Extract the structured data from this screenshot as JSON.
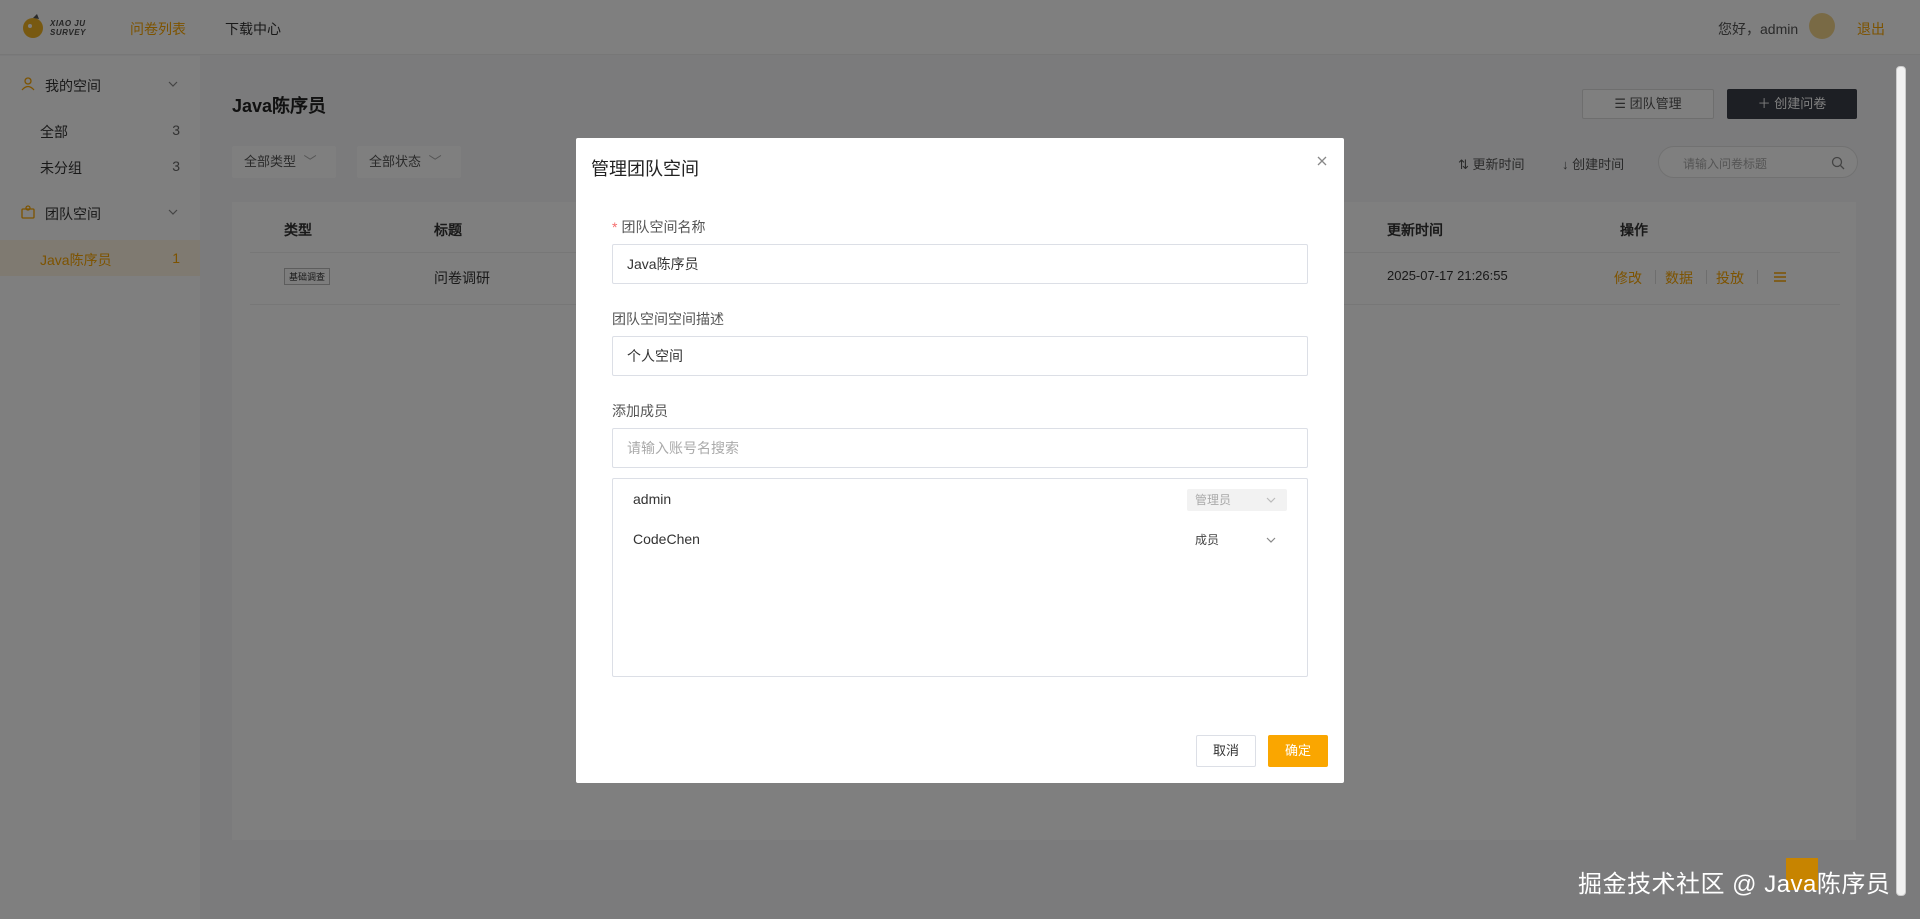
{
  "header": {
    "logo_text_line1": "XIAO JU",
    "logo_text_line2": "SURVEY",
    "nav": [
      {
        "label": "问卷列表",
        "active": true
      },
      {
        "label": "下载中心",
        "active": false
      }
    ],
    "greeting": "您好，admin",
    "logout_label": "退出",
    "accent_color": "#faa600"
  },
  "sidebar": {
    "groups": [
      {
        "label": "我的空间",
        "icon": "user-icon",
        "items": [
          {
            "label": "全部",
            "count": "3"
          },
          {
            "label": "未分组",
            "count": "3"
          }
        ]
      },
      {
        "label": "团队空间",
        "icon": "team-icon",
        "items": [
          {
            "label": "Java陈序员",
            "count": "1",
            "active": true
          }
        ]
      }
    ]
  },
  "main": {
    "title": "Java陈序员",
    "team_manage_label": "团队管理",
    "create_label": "创建问卷",
    "filters": [
      "全部类型",
      "全部状态"
    ],
    "sorts": [
      "更新时间",
      "创建时间"
    ],
    "search_placeholder": "请输入问卷标题",
    "table": {
      "headers": [
        "类型",
        "标题",
        "更新时间",
        "操作"
      ],
      "rows": [
        {
          "type_tag": "基础调查",
          "title": "问卷调研",
          "updated": "2025-07-17 21:26:55",
          "actions": [
            "修改",
            "数据",
            "投放"
          ]
        }
      ]
    }
  },
  "modal": {
    "title": "管理团队空间",
    "name_label": "团队空间名称",
    "name_value": "Java陈序员",
    "desc_label": "团队空间空间描述",
    "desc_value": "个人空间",
    "member_label": "添加成员",
    "member_placeholder": "请输入账号名搜索",
    "members": [
      {
        "name": "admin",
        "role": "管理员",
        "disabled": true
      },
      {
        "name": "CodeChen",
        "role": "成员",
        "disabled": false
      }
    ],
    "cancel_label": "取消",
    "ok_label": "确定"
  },
  "watermark": "掘金技术社区 @ Java陈序员"
}
